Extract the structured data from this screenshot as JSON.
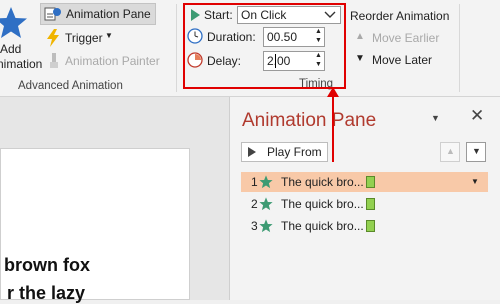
{
  "ribbon": {
    "add_label_line1": "Add",
    "add_label_line2": "nimation",
    "animation_pane": "Animation Pane",
    "trigger": "Trigger",
    "animation_painter": "Animation Painter",
    "advanced_group": "Advanced Animation",
    "start_label": "Start:",
    "start_value": "On Click",
    "duration_label": "Duration:",
    "duration_value": "00.50",
    "delay_label": "Delay:",
    "delay_value": "2.00",
    "timing_group": "Timing",
    "reorder": "Reorder Animation",
    "move_earlier": "Move Earlier",
    "move_later": "Move Later"
  },
  "slide": {
    "line1": "brown fox",
    "line2": "r the lazy"
  },
  "pane": {
    "title": "Animation Pane",
    "play_from": "Play From",
    "items": [
      {
        "num": "1",
        "label": "The quick bro..."
      },
      {
        "num": "2",
        "label": "The quick bro..."
      },
      {
        "num": "3",
        "label": "The quick bro..."
      }
    ]
  },
  "colors": {
    "annotation_red": "#e00000",
    "pane_title": "#b03a2e",
    "selected_row": "#f8c9a8",
    "star_green": "#3d9b73",
    "star_blue": "#2f6fc4"
  }
}
